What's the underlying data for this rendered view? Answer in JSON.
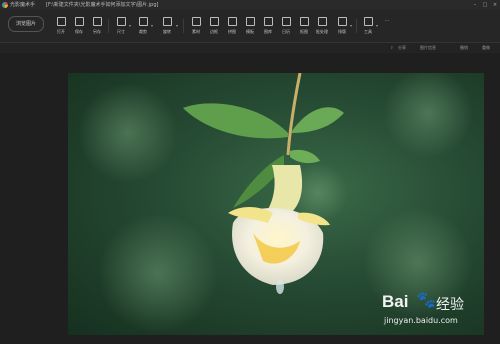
{
  "window": {
    "app_title": "光影魔术手",
    "file_path": "[F:\\新建文件夹\\光影魔术手如何添加文字\\图片.jpg]",
    "controls": [
      "–",
      "□",
      "×"
    ]
  },
  "toolbar": {
    "open_label": "浏览图片",
    "tools": [
      {
        "label": "打开",
        "icon": "folder-icon"
      },
      {
        "label": "保存",
        "icon": "save-icon"
      },
      {
        "label": "另存",
        "icon": "save-as-icon"
      },
      {
        "label": "尺寸",
        "icon": "resize-icon"
      },
      {
        "label": "裁剪",
        "icon": "crop-icon"
      },
      {
        "label": "旋转",
        "icon": "rotate-icon"
      },
      {
        "label": "素材",
        "icon": "sticker-icon"
      },
      {
        "label": "边框",
        "icon": "frame-icon"
      },
      {
        "label": "拼图",
        "icon": "collage-icon"
      },
      {
        "label": "模板",
        "icon": "template-icon"
      },
      {
        "label": "图库",
        "icon": "gallery-icon"
      },
      {
        "label": "日历",
        "icon": "calendar-icon"
      },
      {
        "label": "抠图",
        "icon": "cutout-icon"
      },
      {
        "label": "批处理",
        "icon": "batch-icon"
      },
      {
        "label": "排版",
        "icon": "layout-icon"
      },
      {
        "label": "工具",
        "icon": "wrench-icon"
      },
      {
        "label": "···",
        "icon": "more-icon"
      }
    ]
  },
  "subbar": {
    "share": "分享",
    "info": "图片信息",
    "undo": "撤销",
    "redo": "重做"
  },
  "watermark": {
    "brand": "Bai",
    "suffix": "经验",
    "url": "jingyan.baidu.com"
  }
}
